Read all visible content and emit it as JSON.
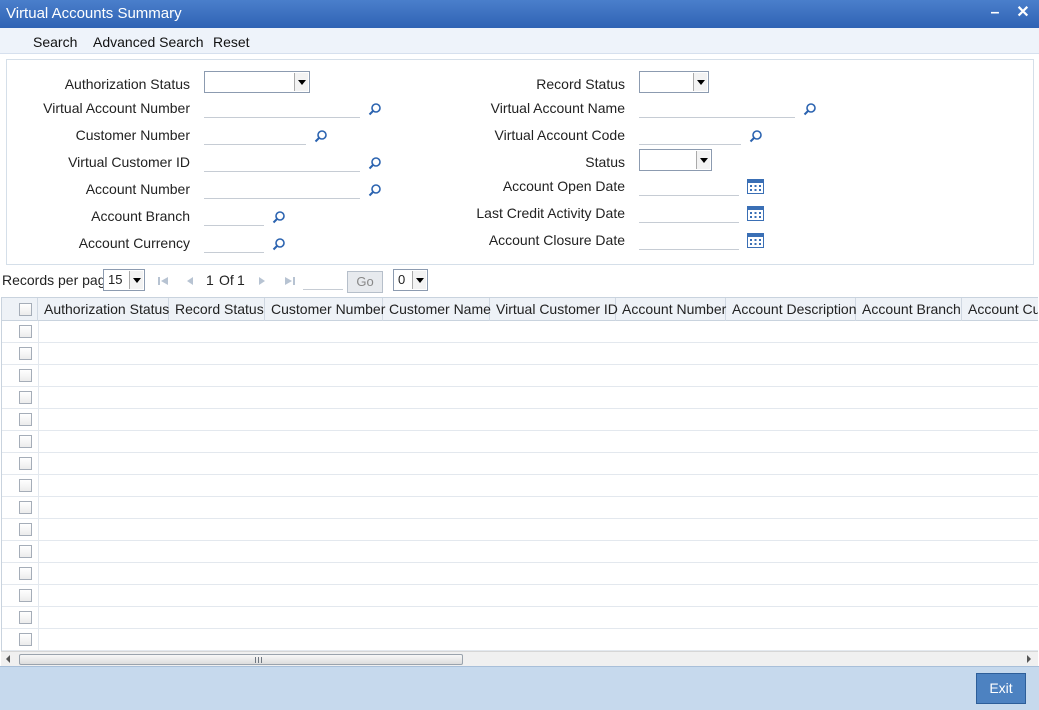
{
  "window": {
    "title": "Virtual Accounts Summary",
    "minimize": "–",
    "close": "✕"
  },
  "toolbar": {
    "search": "Search",
    "advanced_search": "Advanced Search",
    "reset": "Reset"
  },
  "form": {
    "authorization_status": "Authorization Status",
    "virtual_account_number": "Virtual Account Number",
    "customer_number": "Customer Number",
    "virtual_customer_id": "Virtual Customer ID",
    "account_number": "Account Number",
    "account_branch": "Account Branch",
    "account_currency": "Account Currency",
    "record_status": "Record Status",
    "virtual_account_name": "Virtual Account Name",
    "virtual_account_code": "Virtual Account Code",
    "status": "Status",
    "account_open_date": "Account Open Date",
    "last_credit_activity_date": "Last Credit Activity Date",
    "account_closure_date": "Account Closure Date"
  },
  "pager": {
    "records_per_page": "Records per page",
    "per_page_value": "15",
    "page_current": "1",
    "of_label": "Of",
    "page_total": "1",
    "go": "Go",
    "jump_value": "0"
  },
  "grid": {
    "columns": [
      "Authorization Status",
      "Record Status",
      "Customer Number",
      "Customer Name",
      "Virtual Customer ID",
      "Account Number",
      "Account Description",
      "Account Branch",
      "Account Cur"
    ]
  },
  "footer": {
    "exit": "Exit"
  },
  "icons": {
    "search": "magnifier-icon",
    "calendar": "calendar-icon"
  },
  "colors": {
    "titlebar": "#2f63b4",
    "footer": "#c6d9ed",
    "exit_button": "#4d82c1"
  }
}
